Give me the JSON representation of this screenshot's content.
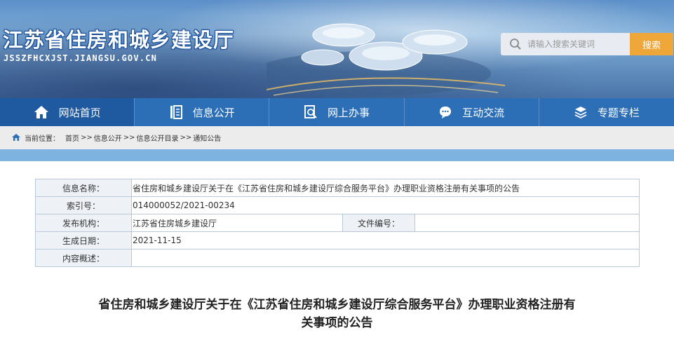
{
  "header": {
    "site_title": "江苏省住房和城乡建设厅",
    "site_domain": "JSSZFHCXJST.JIANGSU.GOV.CN",
    "search": {
      "placeholder": "请输入搜索关键词",
      "button_label": "搜索"
    }
  },
  "nav": {
    "items": [
      {
        "label": "网站首页",
        "icon": "home-icon"
      },
      {
        "label": "信息公开",
        "icon": "document-list-icon"
      },
      {
        "label": "网上办事",
        "icon": "search-doc-icon"
      },
      {
        "label": "互动交流",
        "icon": "chat-icon"
      },
      {
        "label": "专题专栏",
        "icon": "layers-icon"
      }
    ]
  },
  "breadcrumb": {
    "prefix": "当前位置：",
    "items": [
      "首页",
      "信息公开",
      "信息公开目录",
      "通知公告"
    ],
    "separator": ">>"
  },
  "info_table": {
    "name_label": "信息名称：",
    "name_value": "省住房和城乡建设厅关于在《江苏省住房和城乡建设厅综合服务平台》办理职业资格注册有关事项的公告",
    "index_label": "索引号：",
    "index_value": "014000052/2021-00234",
    "publisher_label": "发布机构：",
    "publisher_value": "江苏省住房城乡建设厅",
    "doc_no_label": "文件编号：",
    "doc_no_value": "",
    "date_label": "生成日期：",
    "date_value": "2021-11-15",
    "summary_label": "内容概述：",
    "summary_value": ""
  },
  "article": {
    "title_line1": "省住房和城乡建设厅关于在《江苏省住房和城乡建设厅综合服务平台》办理职业资格注册有",
    "title_line2": "关事项的公告"
  },
  "colors": {
    "nav_bg": "#2d6fb7",
    "search_button": "#f0a73a",
    "crumb_bg": "#ececec",
    "accent_bar": "#7fb3df"
  }
}
